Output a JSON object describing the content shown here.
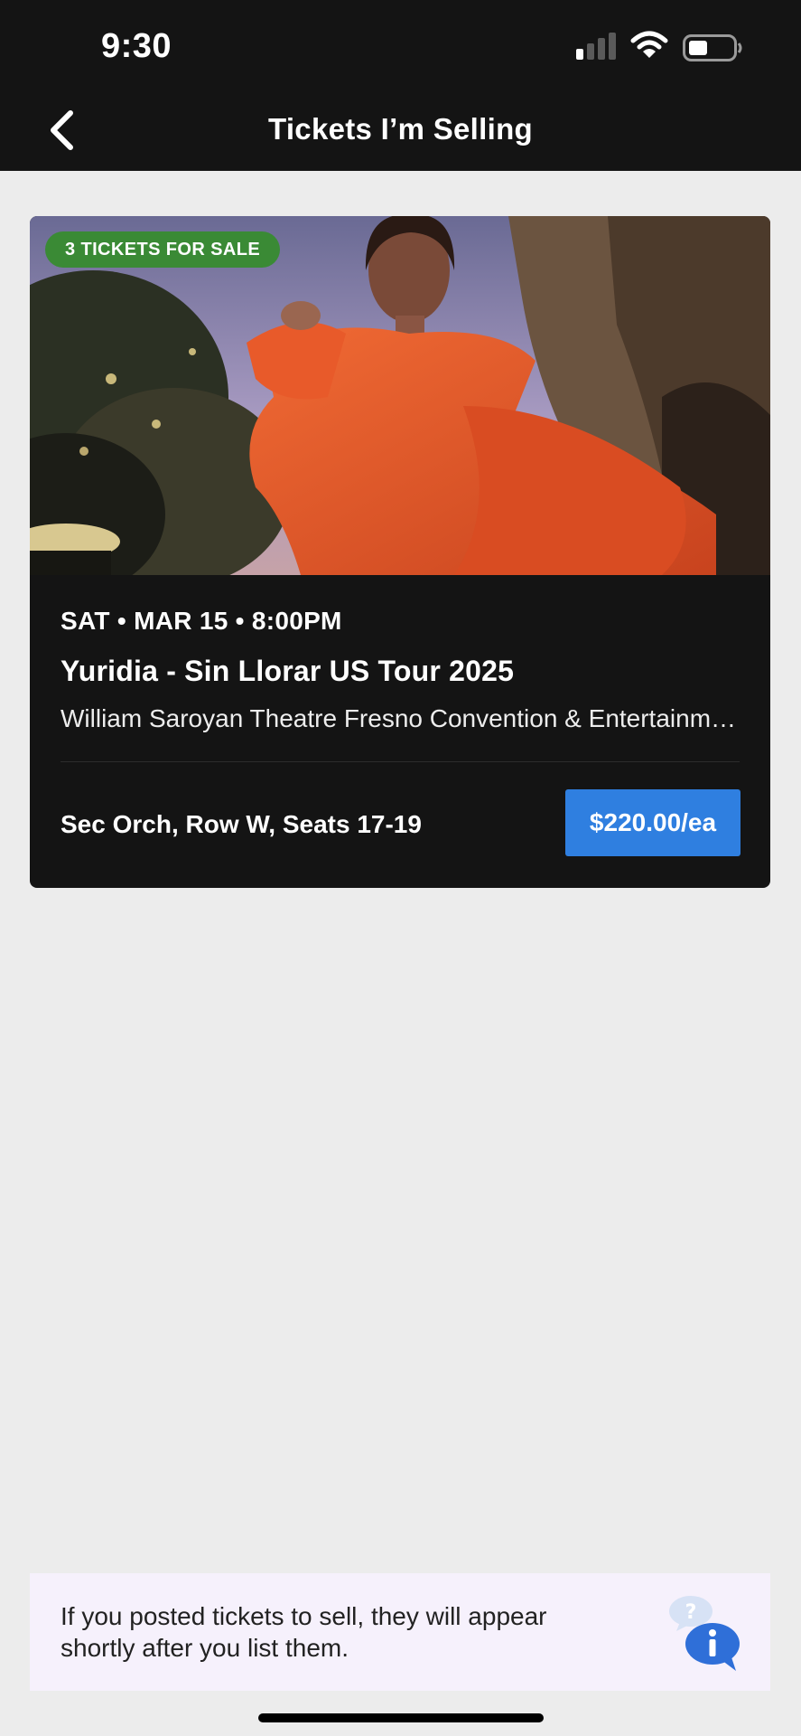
{
  "status_bar": {
    "time": "9:30"
  },
  "nav": {
    "title": "Tickets I’m Selling"
  },
  "listing": {
    "badge": "3 TICKETS FOR SALE",
    "date": "SAT • MAR 15 • 8:00PM",
    "event_name": "Yuridia - Sin Llorar US Tour 2025",
    "venue": "William Saroyan Theatre Fresno Convention & Entertainment Center",
    "seats": "Sec Orch, Row W, Seats 17-19",
    "price": "$220.00/ea"
  },
  "info_banner": {
    "text": "If you posted tickets to sell, they will appear shortly after you list them."
  },
  "colors": {
    "bar_background": "#141414",
    "page_background": "#ececec",
    "badge_green": "#3a8a35",
    "price_blue": "#2f7fe0",
    "banner_background": "#f6f1fc"
  },
  "icons": [
    "back-chevron-icon",
    "signal-icon",
    "wifi-icon",
    "battery-icon",
    "help-chat-icon"
  ]
}
